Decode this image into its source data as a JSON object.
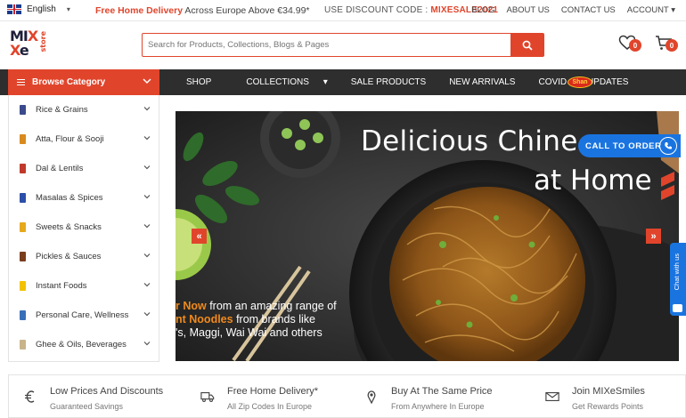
{
  "topbar": {
    "language": "English",
    "promo_highlight": "Free Home Delivery",
    "promo_rest": " Across Europe Above €34.99*",
    "code_label": "USE DISCOUNT CODE : ",
    "code_value": "MIXESALE2021",
    "links": [
      "BLOG",
      "ABOUT US",
      "CONTACT US",
      "ACCOUNT"
    ]
  },
  "logo": {
    "line1_a": "MI",
    "line1_b": "X",
    "line2_a": "X",
    "line2_b": "e",
    "store": "store"
  },
  "search": {
    "placeholder": "Search for Products, Collections, Blogs & Pages"
  },
  "header": {
    "wishlist_count": "0",
    "cart_count": "0"
  },
  "nav": {
    "browse_label": "Browse Category",
    "items": [
      "SHOP",
      "COLLECTIONS",
      "SALE PRODUCTS",
      "NEW ARRIVALS",
      "COVID - 19 UPDATES"
    ],
    "brand_badge": "Shan"
  },
  "categories": [
    {
      "label": "Rice & Grains",
      "color": "#3a4a8c"
    },
    {
      "label": "Atta, Flour & Sooji",
      "color": "#d98a1f"
    },
    {
      "label": "Dal & Lentils",
      "color": "#c0392b"
    },
    {
      "label": "Masalas & Spices",
      "color": "#2c4fa8"
    },
    {
      "label": "Sweets & Snacks",
      "color": "#e6a91c"
    },
    {
      "label": "Pickles & Sauces",
      "color": "#7a3d1c"
    },
    {
      "label": "Instant Foods",
      "color": "#f2c200"
    },
    {
      "label": "Personal Care, Wellness",
      "color": "#3a6fb8"
    },
    {
      "label": "Ghee & Oils, Beverages",
      "color": "#c9b48a"
    }
  ],
  "hero": {
    "title_line1": "Delicious Chine",
    "title_line2": "at Home",
    "sub_line1_highlight": "r Now",
    "sub_line1_rest": " from an amazing range of",
    "sub_line2_highlight": "nt Noodles",
    "sub_line2_rest": " from brands like",
    "sub_line3": "'s, Maggi, Wai Wai and others"
  },
  "call_to_order": "CALL TO ORDER",
  "chat_label": "Chat with us",
  "features": [
    {
      "title": "Low Prices And Discounts",
      "subtitle": "Guaranteed Savings",
      "icon": "euro-icon"
    },
    {
      "title": "Free Home Delivery*",
      "subtitle": "All Zip Codes In Europe",
      "icon": "truck-icon"
    },
    {
      "title": "Buy At The Same Price",
      "subtitle": "From Anywhere In Europe",
      "icon": "pin-icon"
    },
    {
      "title": "Join MIXeSmiles",
      "subtitle": "Get Rewards Points",
      "icon": "envelope-icon"
    }
  ],
  "colors": {
    "accent": "#e0452c",
    "nav_bg": "#2e2e2e",
    "call_blue": "#1a74e0"
  }
}
